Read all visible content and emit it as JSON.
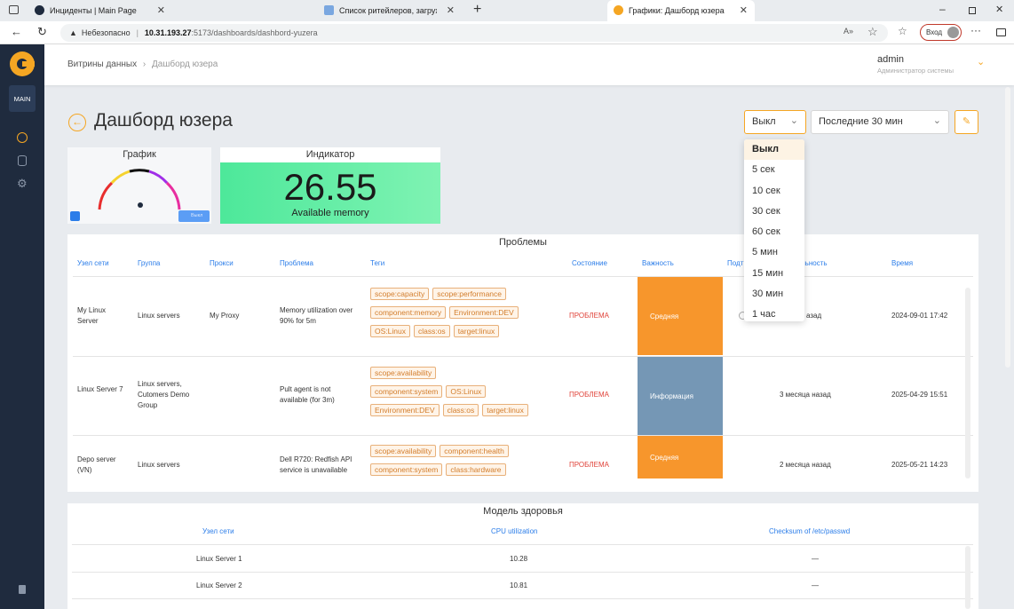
{
  "browser": {
    "tabs": [
      {
        "title": "Инциденты | Main Page",
        "icon": "globe-icon"
      },
      {
        "title": "Список ритейлеров, загружаемых",
        "icon": "puzzle-icon"
      },
      {
        "title": "Графики: Дашборд юзера",
        "icon": "app-logo-icon"
      }
    ],
    "security": "Небезопасно",
    "url_host": "10.31.193.27",
    "url_rest": ":5173/dashboards/dashbord-yuzera",
    "login_label": "Вход"
  },
  "sidebar": {
    "main_label": "MAIN"
  },
  "header": {
    "breadcrumb_root": "Витрины данных",
    "breadcrumb_current": "Дашборд юзера",
    "user_name": "admin",
    "user_role": "Администратор системы"
  },
  "page": {
    "title": "Дашборд юзера"
  },
  "controls": {
    "refresh_value": "Выкл",
    "range_value": "Последние 30 мин",
    "refresh_options": [
      "Выкл",
      "5 сек",
      "10 сек",
      "30 сек",
      "60 сек",
      "5 мин",
      "15 мин",
      "30 мин",
      "1 час"
    ]
  },
  "gauge": {
    "title": "График",
    "small_label": "Выкл"
  },
  "indicator": {
    "title": "Индикатор",
    "value": "26.55",
    "label": "Available memory",
    "color": "#4de89a"
  },
  "problems": {
    "title": "Проблемы",
    "columns": [
      "Узел сети",
      "Группа",
      "Прокси",
      "Проблема",
      "Теги",
      "Состояние",
      "Важность",
      "Подт",
      "льность",
      "Время"
    ],
    "rows": [
      {
        "host": "My Linux Server",
        "group": "Linux servers",
        "proxy": "My Proxy",
        "problem": "Memory utilization over 90% for 5m",
        "tags": [
          "scope:capacity",
          "scope:performance",
          "component:memory",
          "Environment:DEV",
          "OS:Linux",
          "class:os",
          "target:linux"
        ],
        "status": "ПРОБЛЕМА",
        "severity": "Средняя",
        "severity_color": "#f7962c",
        "duration": "азад",
        "time": "2024-09-01 17:42"
      },
      {
        "host": "Linux Server 7",
        "group": "Linux servers, Cutomers Demo Group",
        "proxy": "",
        "problem": "Pult agent is not available (for 3m)",
        "tags": [
          "scope:availability",
          "component:system",
          "OS:Linux",
          "Environment:DEV",
          "class:os",
          "target:linux"
        ],
        "status": "ПРОБЛЕМА",
        "severity": "Информация",
        "severity_color": "#7597b5",
        "duration": "3 месяца назад",
        "time": "2025-04-29 15:51"
      },
      {
        "host": "Depo server (VN)",
        "group": "Linux servers",
        "proxy": "",
        "problem": "Dell R720: Redfish API service is unavailable",
        "tags": [
          "scope:availability",
          "component:health",
          "component:system",
          "class:hardware"
        ],
        "status": "ПРОБЛЕМА",
        "severity": "Средняя",
        "severity_color": "#f7962c",
        "duration": "2 месяца назад",
        "time": "2025-05-21 14:23"
      }
    ]
  },
  "health": {
    "title": "Модель здоровья",
    "columns": [
      "Узел сети",
      "CPU utilization",
      "Checksum of /etc/passwd"
    ],
    "rows": [
      {
        "host": "Linux Server 1",
        "cpu": "10.28",
        "checksum": "—"
      },
      {
        "host": "Linux Server 2",
        "cpu": "10.81",
        "checksum": "—"
      }
    ]
  },
  "colors": {
    "accent": "#f5a623",
    "sidebar": "#1f2b3e",
    "link": "#2b7de9",
    "problem": "#e0433a"
  }
}
